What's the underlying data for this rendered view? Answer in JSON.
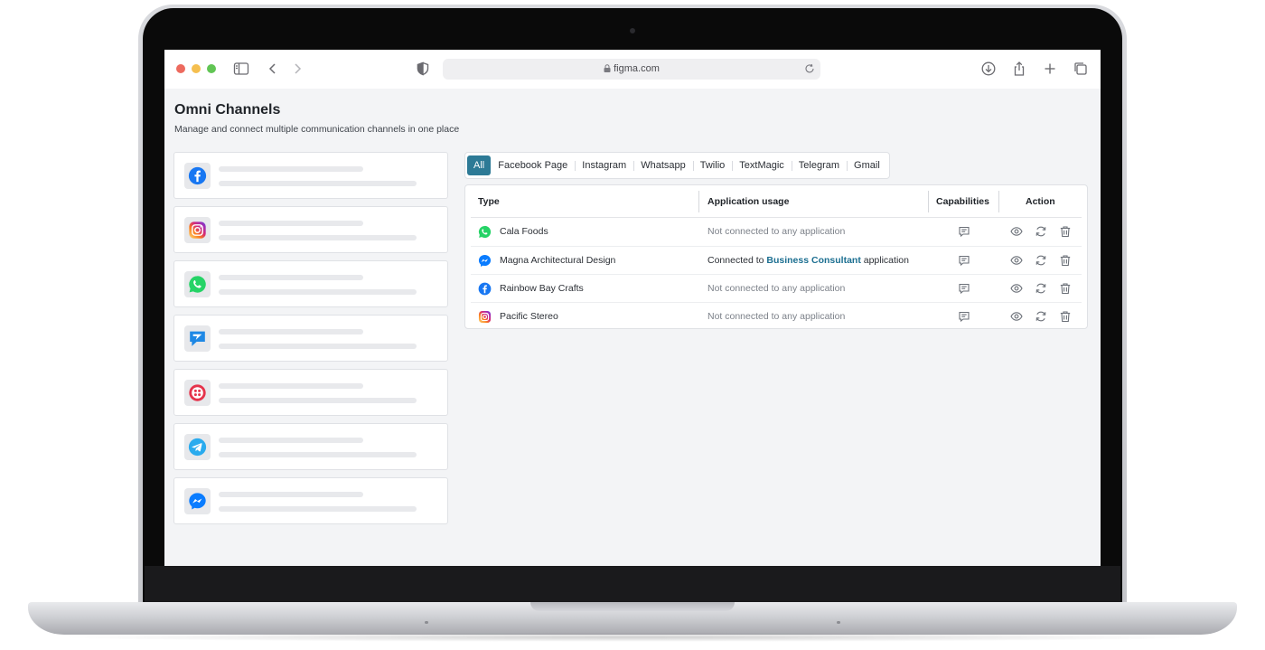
{
  "browser": {
    "url": "figma.com"
  },
  "page": {
    "title": "Omni Channels",
    "subtitle": "Manage and connect multiple communication channels in one place"
  },
  "channels": [
    {
      "icon": "facebook-icon"
    },
    {
      "icon": "instagram-icon"
    },
    {
      "icon": "whatsapp-icon"
    },
    {
      "icon": "textmagic-icon"
    },
    {
      "icon": "twilio-icon"
    },
    {
      "icon": "telegram-icon"
    },
    {
      "icon": "messenger-icon"
    }
  ],
  "tabs": [
    "All",
    "Facebook Page",
    "Instagram",
    "Whatsapp",
    "Twilio",
    "TextMagic",
    "Telegram",
    "Gmail"
  ],
  "active_tab": "All",
  "table": {
    "headers": {
      "type": "Type",
      "usage": "Application usage",
      "capabilities": "Capabilities",
      "action": "Action"
    },
    "rows": [
      {
        "icon": "whatsapp-icon",
        "name": "Cala Foods",
        "usage_prefix": "Not connected to any application",
        "usage_link": "",
        "usage_suffix": ""
      },
      {
        "icon": "messenger-icon",
        "name": "Magna Architectural Design",
        "usage_prefix": "Connected to",
        "usage_link": "Business Consultant",
        "usage_suffix": "application"
      },
      {
        "icon": "facebook-icon",
        "name": "Rainbow Bay Crafts",
        "usage_prefix": "Not connected to any application",
        "usage_link": "",
        "usage_suffix": ""
      },
      {
        "icon": "instagram-icon",
        "name": "Pacific Stereo",
        "usage_prefix": "Not connected to any application",
        "usage_link": "",
        "usage_suffix": ""
      }
    ]
  },
  "colors": {
    "accent": "#2d7a96",
    "link": "#1c6f91",
    "facebook": "#1877f2",
    "whatsapp": "#25d366",
    "telegram": "#2aabee",
    "twilio": "#e5334b",
    "messenger": "#0a7cff",
    "textmagic": "#1e88e5"
  }
}
